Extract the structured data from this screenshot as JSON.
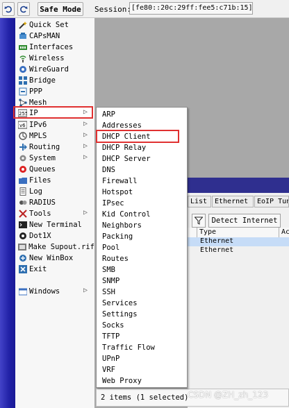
{
  "toolbar": {
    "safe_mode_label": "Safe Mode",
    "session_label": "Session:",
    "session_value": "[fe80::20c:29ff:fee5:c71b:15]"
  },
  "menu": {
    "items": [
      {
        "label": "Quick Set",
        "icon": "wand-icon",
        "arrow": false
      },
      {
        "label": "CAPsMAN",
        "icon": "capsman-icon",
        "arrow": false
      },
      {
        "label": "Interfaces",
        "icon": "interfaces-icon",
        "arrow": false
      },
      {
        "label": "Wireless",
        "icon": "wireless-icon",
        "arrow": false
      },
      {
        "label": "WireGuard",
        "icon": "wireguard-icon",
        "arrow": false
      },
      {
        "label": "Bridge",
        "icon": "bridge-icon",
        "arrow": false
      },
      {
        "label": "PPP",
        "icon": "ppp-icon",
        "arrow": false
      },
      {
        "label": "Mesh",
        "icon": "mesh-icon",
        "arrow": false
      },
      {
        "label": "IP",
        "icon": "ip-icon",
        "arrow": true
      },
      {
        "label": "IPv6",
        "icon": "ipv6-icon",
        "arrow": true
      },
      {
        "label": "MPLS",
        "icon": "mpls-icon",
        "arrow": true
      },
      {
        "label": "Routing",
        "icon": "routing-icon",
        "arrow": true
      },
      {
        "label": "System",
        "icon": "gear-icon",
        "arrow": true
      },
      {
        "label": "Queues",
        "icon": "queues-icon",
        "arrow": false
      },
      {
        "label": "Files",
        "icon": "folder-icon",
        "arrow": false
      },
      {
        "label": "Log",
        "icon": "log-icon",
        "arrow": false
      },
      {
        "label": "RADIUS",
        "icon": "radius-icon",
        "arrow": false
      },
      {
        "label": "Tools",
        "icon": "tools-icon",
        "arrow": true
      },
      {
        "label": "New Terminal",
        "icon": "terminal-icon",
        "arrow": false
      },
      {
        "label": "Dot1X",
        "icon": "dot1x-icon",
        "arrow": false
      },
      {
        "label": "Make Supout.rif",
        "icon": "supout-icon",
        "arrow": false
      },
      {
        "label": "New WinBox",
        "icon": "winbox-icon",
        "arrow": false
      },
      {
        "label": "Exit",
        "icon": "exit-icon",
        "arrow": false
      }
    ],
    "windows_label": "Windows"
  },
  "ip_submenu": {
    "items": [
      "ARP",
      "Addresses",
      "DHCP Client",
      "DHCP Relay",
      "DHCP Server",
      "DNS",
      "Firewall",
      "Hotspot",
      "IPsec",
      "Kid Control",
      "Neighbors",
      "Packing",
      "Pool",
      "Routes",
      "SMB",
      "SNMP",
      "SSH",
      "Services",
      "Settings",
      "Socks",
      "TFTP",
      "Traffic Flow",
      "UPnP",
      "VRF",
      "Web Proxy"
    ]
  },
  "dhcp_window": {
    "tabs": [
      "List",
      "Ethernet",
      "EoIP Tun"
    ],
    "detect_label": "Detect Internet",
    "columns": [
      "Type",
      "Ac"
    ],
    "rows": [
      "Ethernet",
      "Ethernet"
    ]
  },
  "status": {
    "text": "2 items (1 selected)",
    "watermark": "CSDN @ZH_zh_123"
  }
}
